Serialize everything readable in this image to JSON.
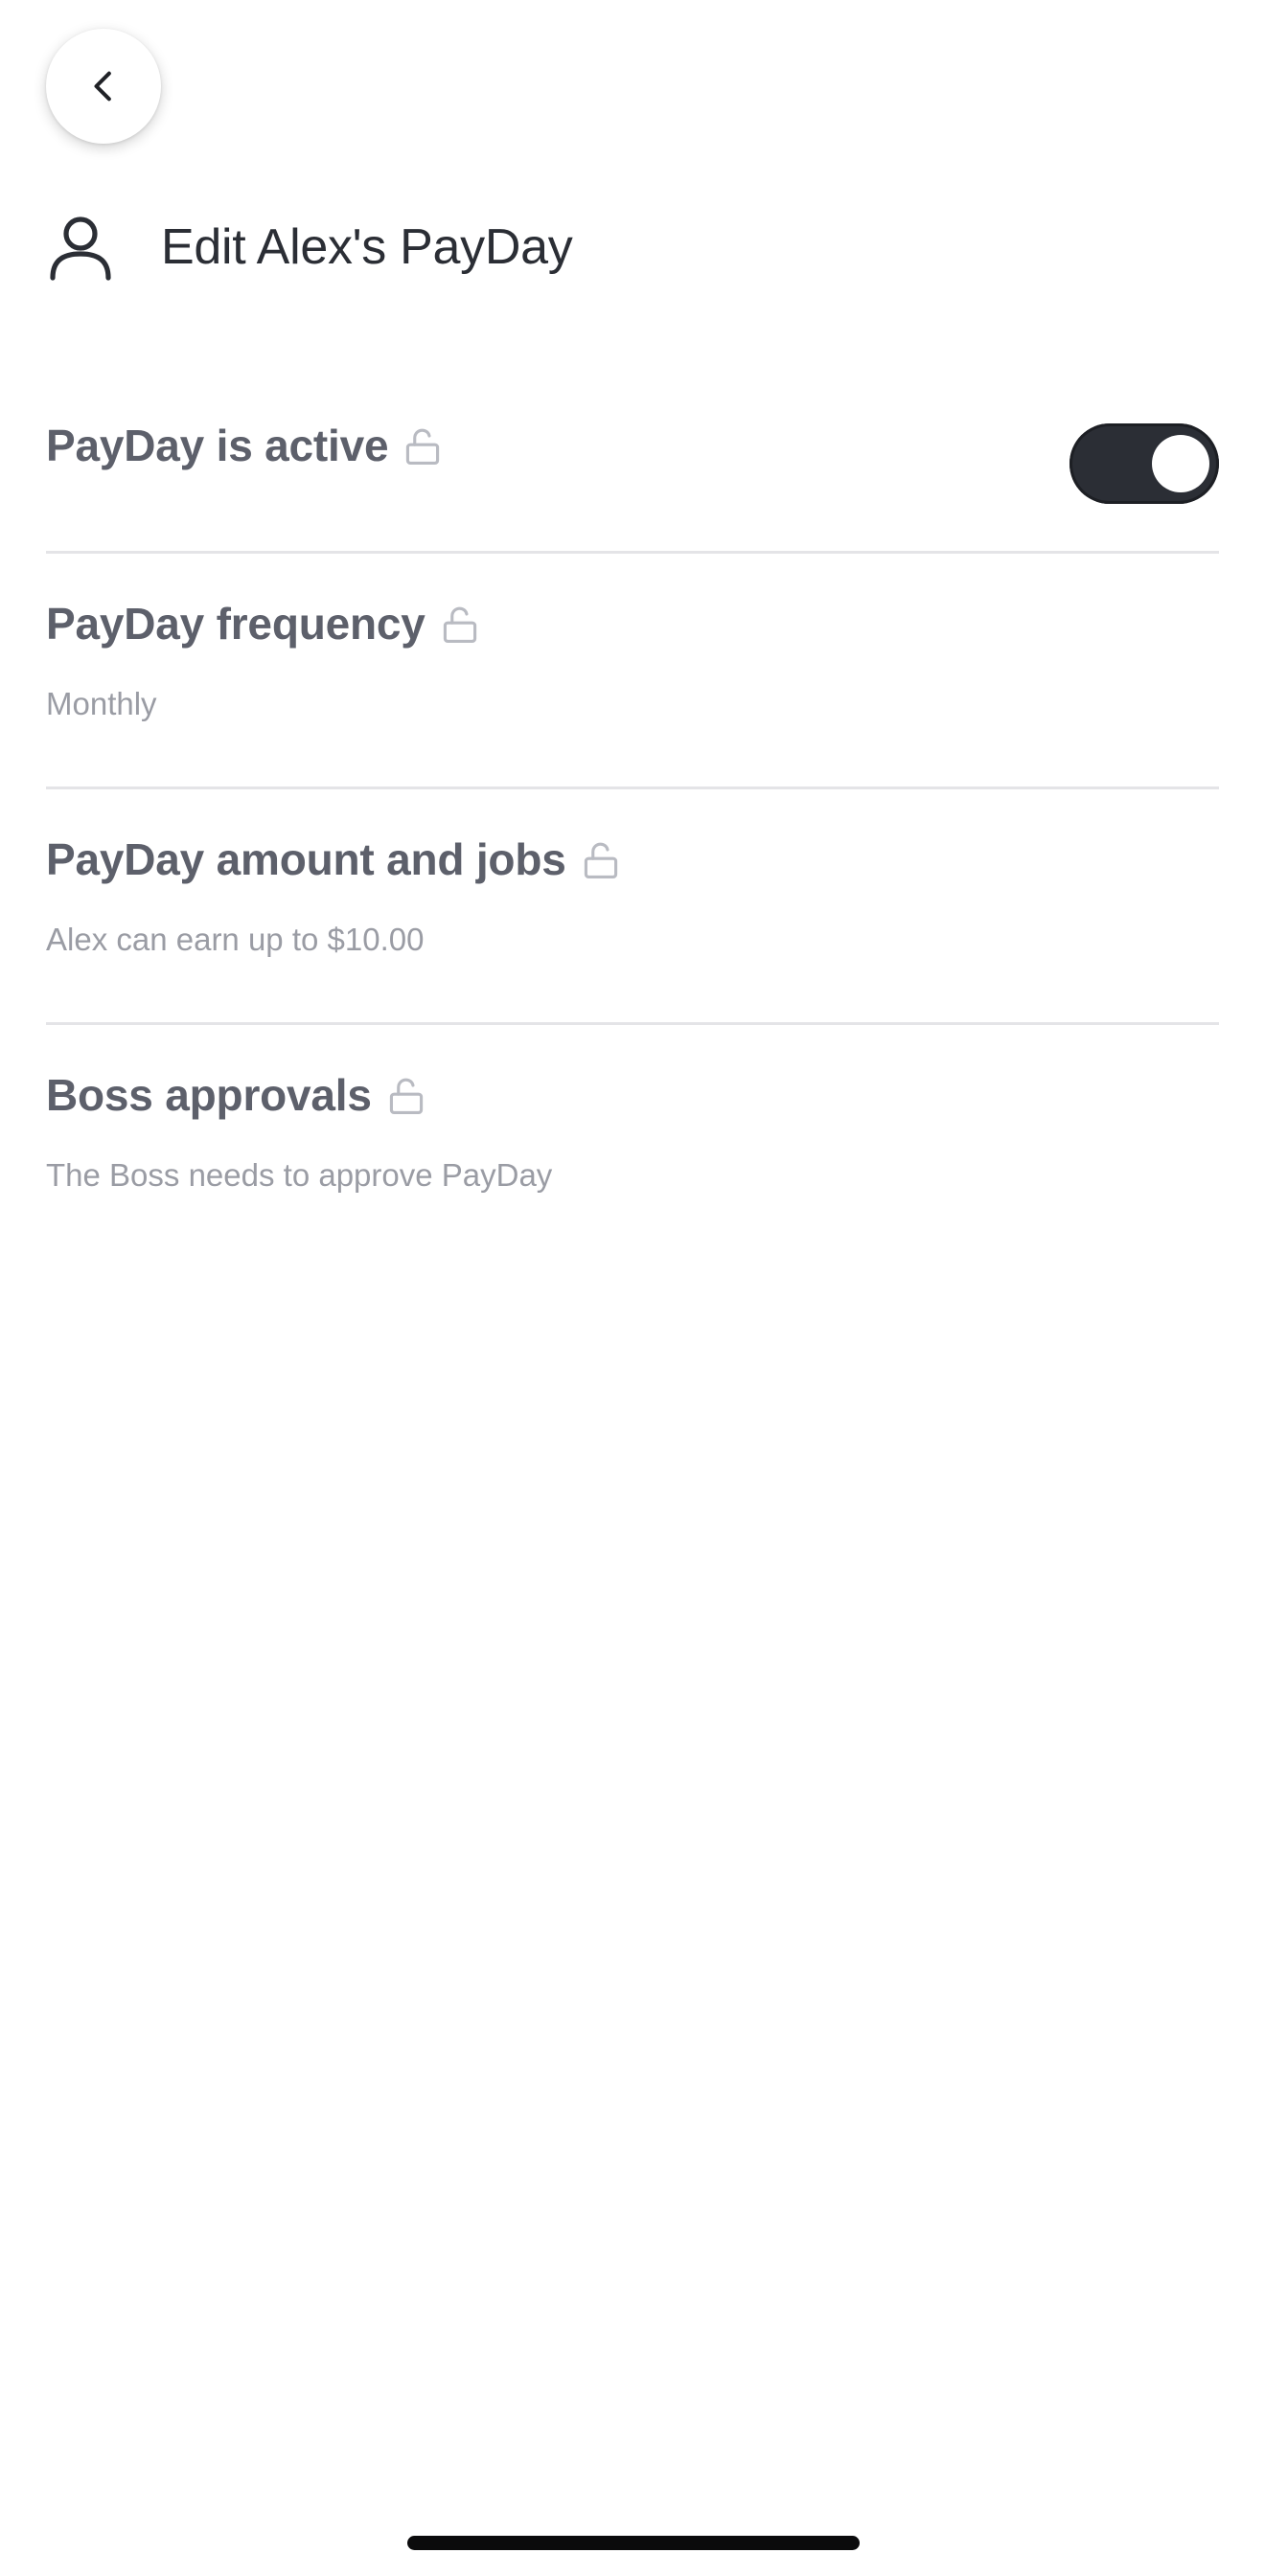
{
  "header": {
    "title": "Edit Alex's PayDay",
    "icon": "person-icon"
  },
  "nav": {
    "back_icon": "chevron-left-icon"
  },
  "settings": {
    "active": {
      "label": "PayDay is active",
      "toggle_on": true,
      "lock_icon": "unlocked-icon"
    },
    "frequency": {
      "label": "PayDay frequency",
      "value": "Monthly",
      "lock_icon": "unlocked-icon"
    },
    "amount": {
      "label": "PayDay amount and jobs",
      "value": "Alex can earn up to $10.00",
      "lock_icon": "unlocked-icon"
    },
    "approvals": {
      "label": "Boss approvals",
      "value": "The Boss needs to approve PayDay",
      "lock_icon": "unlocked-icon"
    }
  },
  "colors": {
    "title_text": "#2b2e35",
    "row_label": "#5d606b",
    "row_value": "#9a9ca4",
    "toggle_on": "#2b2e35",
    "divider": "#e4e4e7",
    "lock_icon": "#b9bbc2"
  }
}
